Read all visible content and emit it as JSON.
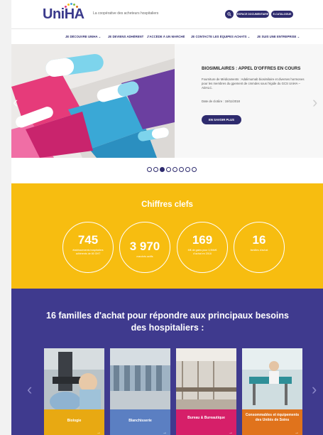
{
  "header": {
    "logo": "UniHA",
    "tagline": "La coopérative des acheteurs hospitaliers",
    "espace_label": "ESPACE DOCUMENTAIRE",
    "catalogue_label": "E-CATALOGUE"
  },
  "nav": {
    "items": [
      {
        "label": "JE DÉCOUVRE UNIHA ⌄"
      },
      {
        "label": "JE DEVIENS ADHÉRENT"
      },
      {
        "label": "J'ACCÈDE À UN MARCHÉ"
      },
      {
        "label": "JE CONTACTE LES ÉQUIPES ACHATS ⌄"
      },
      {
        "label": "JE SUIS UNE ENTREPRISE ⌄"
      }
    ]
  },
  "hero": {
    "title": "BIOSIMILAIRES : APPEL D'OFFRES EN COURS",
    "text": "Fourniture de Médicaments : Adalimumab biosimilaire et diverses hormones pour les membres du gpement de cmmdes sous l'égide du GCS UniHA – ADALC.",
    "date": "Date de clotûre : 19/11/2018",
    "button": "EN SAVOIR PLUS",
    "active_slide": 3,
    "slide_count": 8
  },
  "figures": {
    "title": "Chiffres clefs",
    "items": [
      {
        "number": "745",
        "caption": "établissements hospitaliers adhérents de 80 GHT"
      },
      {
        "number": "3 970",
        "caption": "marchés actifs"
      },
      {
        "number": "169",
        "caption": "M€ de gains pour 3,9Md€ d'achat en 2018"
      },
      {
        "number": "16",
        "caption": "familles d'achat"
      }
    ]
  },
  "families": {
    "title": "16 familles d'achat pour répondre aux principaux besoins des hospitaliers :",
    "cards": [
      {
        "label": "Biologie",
        "color": "#e8a912"
      },
      {
        "label": "Blanchisserie",
        "color": "#5b7fc2"
      },
      {
        "label": "Bureau & Bureautique",
        "color": "#d61f69"
      },
      {
        "label": "Consommables et équipements des Unités de Soins",
        "color": "#e0731c"
      }
    ],
    "card_arrow": "→"
  },
  "colors": {
    "brand": "#2e2b6e",
    "yellow": "#f7bd10",
    "purple": "#3f3a8e"
  }
}
